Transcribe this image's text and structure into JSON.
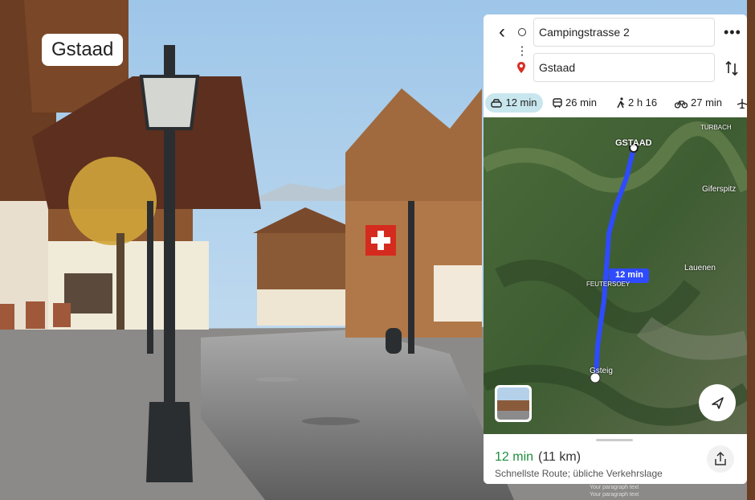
{
  "photo": {
    "place_label": "Gstaad"
  },
  "directions": {
    "from": "Campingstrasse 2",
    "to": "Gstaad",
    "modes": [
      {
        "name": "car-icon",
        "label": "12 min",
        "active": true
      },
      {
        "name": "transit-icon",
        "label": "26 min",
        "active": false
      },
      {
        "name": "walk-icon",
        "label": "2 h 16",
        "active": false
      },
      {
        "name": "bike-icon",
        "label": "27 min",
        "active": false
      },
      {
        "name": "flight-icon",
        "label": "",
        "active": false
      }
    ],
    "map": {
      "labels": {
        "turbach": "TURBACH",
        "gstaad": "GSTAAD",
        "giferspitz": "Giferspitz",
        "lauenen": "Lauenen",
        "feutersoey": "FEUTERSOEY",
        "gsteig": "Gsteig"
      },
      "route_badge": "12 min",
      "route_color": "#2f4bff"
    },
    "summary": {
      "time": "12 min",
      "distance": "(11 km)",
      "note": "Schnellste Route; übliche Verkehrslage"
    }
  },
  "footer": {
    "line1": "Your paragraph text",
    "line2": "Your paragraph text"
  }
}
